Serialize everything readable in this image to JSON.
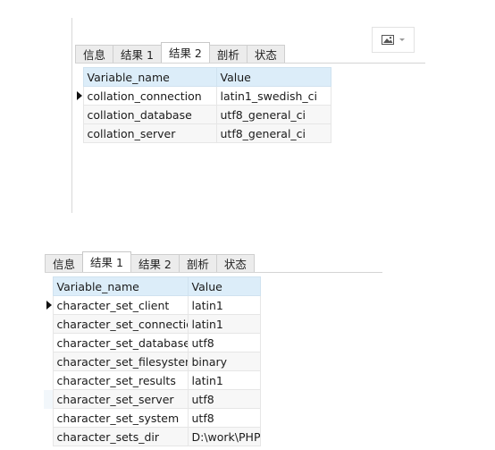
{
  "top": {
    "tabs": [
      "信息",
      "结果 1",
      "结果 2",
      "剖析",
      "状态"
    ],
    "active_tab": 2,
    "headers": [
      "Variable_name",
      "Value"
    ],
    "rows": [
      {
        "name": "collation_connection",
        "value": "latin1_swedish_ci"
      },
      {
        "name": "collation_database",
        "value": "utf8_general_ci"
      },
      {
        "name": "collation_server",
        "value": "utf8_general_ci"
      }
    ]
  },
  "bottom": {
    "tabs": [
      "信息",
      "结果 1",
      "结果 2",
      "剖析",
      "状态"
    ],
    "active_tab": 1,
    "headers": [
      "Variable_name",
      "Value"
    ],
    "rows": [
      {
        "name": "character_set_client",
        "value": "latin1"
      },
      {
        "name": "character_set_connection",
        "value": "latin1"
      },
      {
        "name": "character_set_database",
        "value": "utf8"
      },
      {
        "name": "character_set_filesystem",
        "value": "binary"
      },
      {
        "name": "character_set_results",
        "value": "latin1"
      },
      {
        "name": "character_set_server",
        "value": "utf8"
      },
      {
        "name": "character_set_system",
        "value": "utf8"
      },
      {
        "name": "character_sets_dir",
        "value": "D:\\work\\PHPS"
      }
    ]
  },
  "toolbar": {
    "image_button_icon": "image-icon"
  }
}
